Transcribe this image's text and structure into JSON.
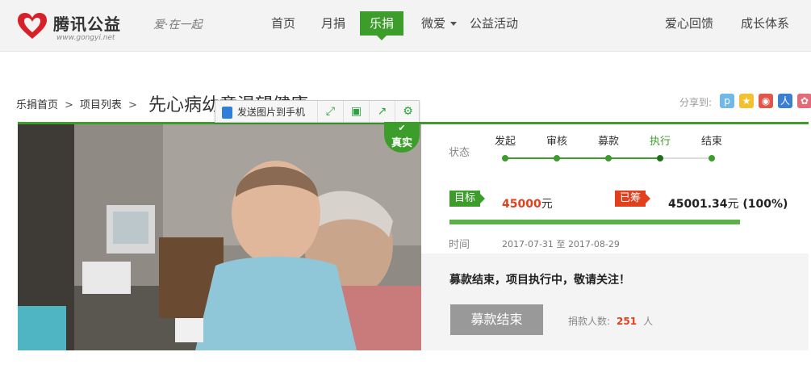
{
  "header": {
    "brand": "腾讯公益",
    "brand_url": "www.gongyi.net",
    "slogan": "爱·在一起",
    "nav": [
      {
        "label": "首页"
      },
      {
        "label": "月捐"
      },
      {
        "label": "乐捐",
        "active": true
      },
      {
        "label": "微爱",
        "dropdown": true
      },
      {
        "label": "公益活动"
      },
      {
        "label": "爱心回馈"
      },
      {
        "label": "成长体系"
      }
    ],
    "accent": "#3d9d2a"
  },
  "breadcrumb": {
    "items": [
      "乐捐首页",
      "项目列表"
    ],
    "title": "先心病幼童渴望健康"
  },
  "share": {
    "label": "分享到:",
    "icons": [
      "qzone-icon",
      "star-icon",
      "weibo-icon",
      "renren-icon",
      "pengyou-icon"
    ]
  },
  "image_toolbar": {
    "send_label": "发送图片到手机",
    "buttons": [
      "expand-icon",
      "save-icon",
      "share-out-icon",
      "settings-icon"
    ]
  },
  "verified_badge": "真实",
  "project": {
    "status_label": "状态",
    "steps": [
      "发起",
      "审核",
      "募款",
      "执行",
      "结束"
    ],
    "current_step": "执行",
    "goal_label": "目标",
    "goal_value": "45000",
    "goal_unit": "元",
    "raised_label": "已筹",
    "raised_value": "45001.34",
    "raised_unit": "元",
    "raised_percent": "(100%)",
    "progress": 1.0,
    "time_label": "时间",
    "time_start": "2017-07-31",
    "time_to": "至",
    "time_end": "2017-08-29",
    "notice": "募款结束，项目执行中，敬请关注！",
    "end_button": "募款结束",
    "donors_label": "捐款人数:",
    "donors_count": "251",
    "donors_unit": "人"
  }
}
